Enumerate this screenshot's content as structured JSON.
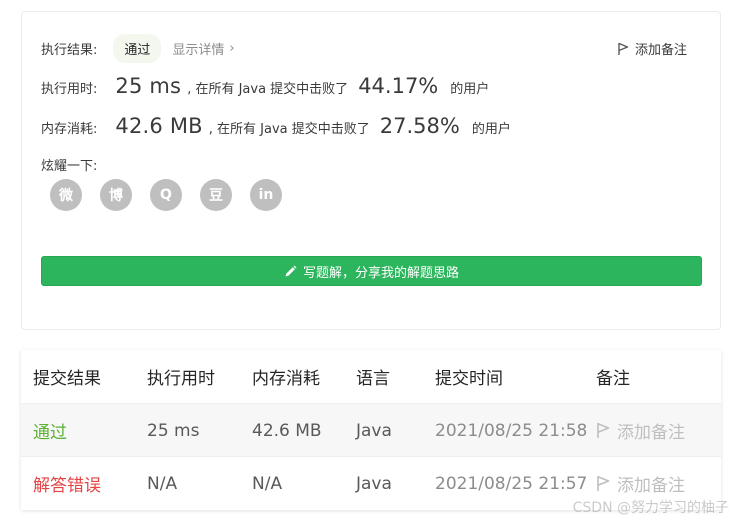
{
  "summary": {
    "result_label": "执行结果:",
    "result_value": "通过",
    "details_link": "显示详情",
    "details_chevron": "›",
    "add_note": "添加备注",
    "time_label": "执行用时:",
    "time_value": "25 ms",
    "time_sep": ", 在所有 Java 提交中击败了",
    "time_pct": "44.17%",
    "time_suffix": "的用户",
    "mem_label": "内存消耗:",
    "mem_value": "42.6 MB",
    "mem_sep": ", 在所有 Java 提交中击败了",
    "mem_pct": "27.58%",
    "mem_suffix": "的用户",
    "share_label": "炫耀一下:",
    "share_icons": [
      "wechat-icon",
      "weibo-icon",
      "qq-icon",
      "douban-icon",
      "linkedin-icon"
    ],
    "share_glyphs": [
      "微",
      "博",
      "Q",
      "豆",
      "in"
    ],
    "solution_button": "写题解，分享我的解题思路"
  },
  "table": {
    "headers": [
      "提交结果",
      "执行用时",
      "内存消耗",
      "语言",
      "提交时间",
      "备注"
    ],
    "rows": [
      {
        "status": "通过",
        "time": "25 ms",
        "memory": "42.6 MB",
        "language": "Java",
        "submitted": "2021/08/25 21:58",
        "note": "添加备注"
      },
      {
        "status": "解答错误",
        "time": "N/A",
        "memory": "N/A",
        "language": "Java",
        "submitted": "2021/08/25 21:57",
        "note": "添加备注"
      }
    ]
  },
  "watermark": "CSDN @努力学习的柚子",
  "colors": {
    "accent_green": "#2db55d",
    "pass_green": "#5cb034",
    "error_red": "#e64444",
    "icon_gray": "#bfbfbf"
  }
}
